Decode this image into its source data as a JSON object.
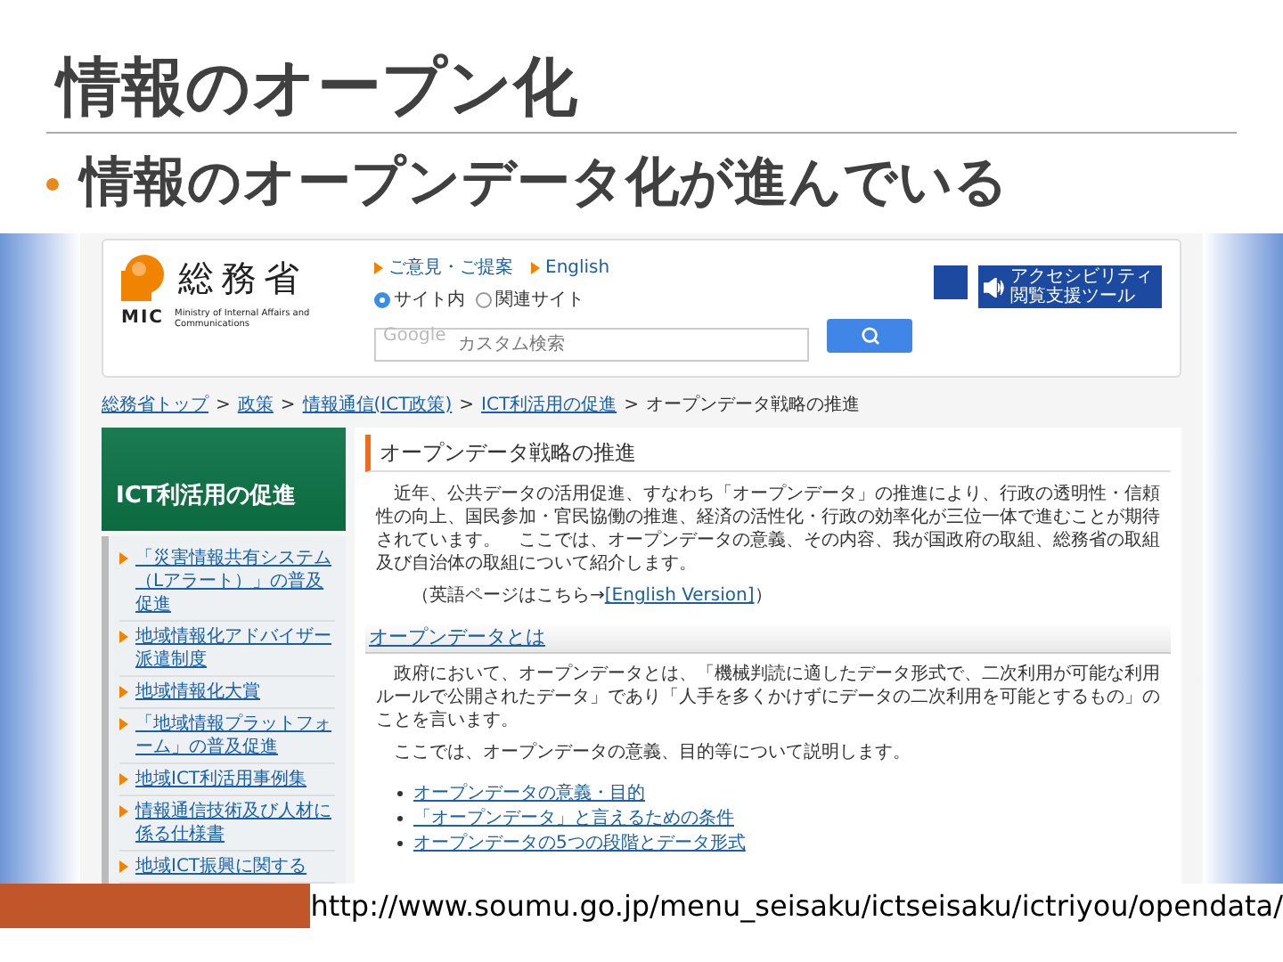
{
  "slide": {
    "title": "情報のオープン化",
    "bullet": "情報のオープンデータ化が進んでいる"
  },
  "screenshot": {
    "header": {
      "logo": {
        "name": "総務省",
        "abbr": "MIC",
        "english": "Ministry of Internal Affairs and Communications"
      },
      "links": [
        "ご意見・ご提案",
        "English"
      ],
      "scopes": [
        {
          "label": "サイト内",
          "selected": true
        },
        {
          "label": "関連サイト",
          "selected": false
        }
      ],
      "search": {
        "brand": "Google",
        "placeholder": "カスタム検索"
      },
      "accessibility": "アクセシビリティ閲覧支援ツール"
    },
    "breadcrumb": [
      {
        "label": "総務省トップ",
        "kind": "link"
      },
      {
        "separator": ">",
        "label": "政策",
        "kind": "link"
      },
      {
        "separator": ">",
        "label": "情報通信(ICT政策)",
        "kind": "link"
      },
      {
        "separator": ">",
        "label": "ICT利活用の促進",
        "kind": "link"
      },
      {
        "separator": ">",
        "label": "オープンデータ戦略の推進",
        "kind": "current"
      }
    ],
    "sidebar": {
      "title": "ICT利活用の促進",
      "items": [
        "「災害情報共有システム（Lアラート）」の普及促進",
        "地域情報化アドバイザー派遣制度",
        "地域情報化大賞",
        "「地域情報プラットフォーム」の普及促進",
        "地域ICT利活用事例集",
        "情報通信技術及び人材に係る仕様書",
        "地域ICT振興に関する"
      ]
    },
    "main": {
      "heading": "オープンデータ戦略の推進",
      "intro": "近年、公共データの活用促進、すなわち「オープンデータ」の推進により、行政の透明性・信頼性の向上、国民参加・官民協働の推進、経済の活性化・行政の効率化が三位一体で進むことが期待されています。　ここでは、オープンデータの意義、その内容、我が国政府の取組、総務省の取組及び自治体の取組について紹介します。",
      "english_note": {
        "before": "（英語ページはこちら→",
        "link": "[English Version]",
        "after": "）"
      },
      "section": {
        "heading": "オープンデータとは",
        "paragraphs": [
          "政府において、オープンデータとは、「機械判読に適したデータ形式で、二次利用が可能な利用ルールで公開されたデータ」であり「人手を多くかけずにデータの二次利用を可能とするもの」のことを言います。",
          "ここでは、オープンデータの意義、目的等について説明します。"
        ],
        "links": [
          "オープンデータの意義・目的",
          "「オープンデータ」と言えるための条件",
          "オープンデータの5つの段階とデータ形式"
        ]
      }
    }
  },
  "footer_url": "http://www.soumu.go.jp/menu_seisaku/ictseisaku/ictriyou/opendata/"
}
